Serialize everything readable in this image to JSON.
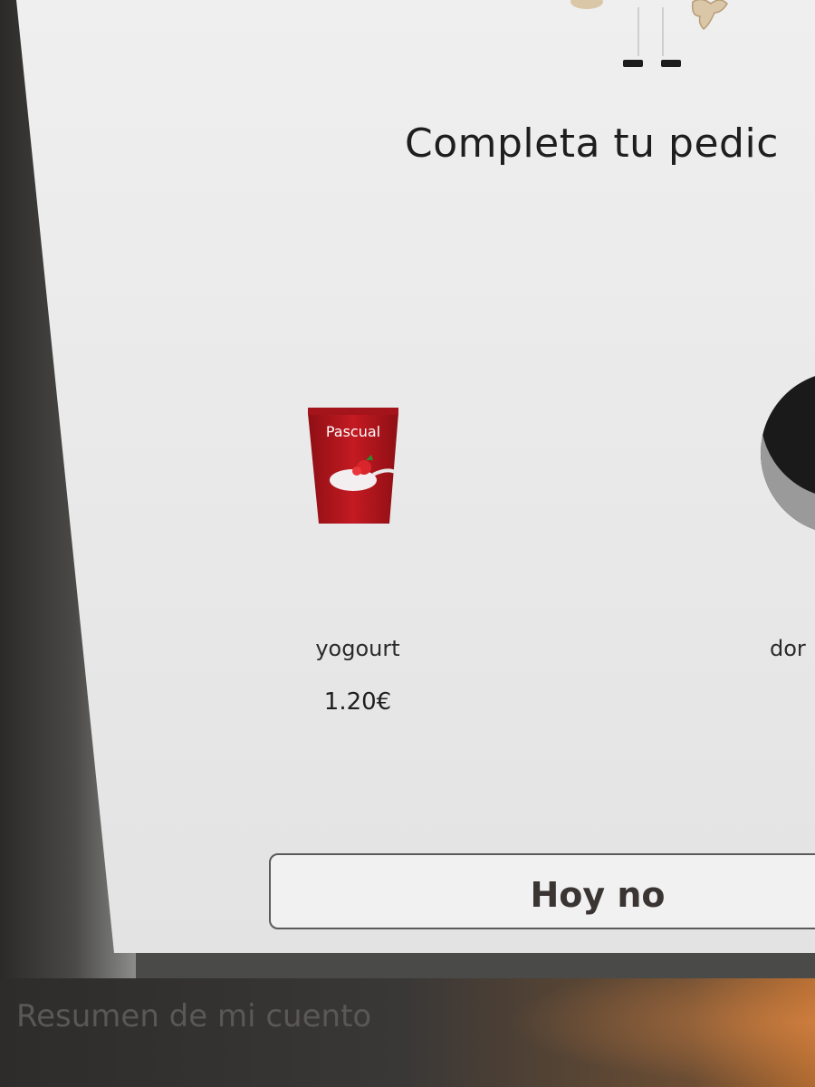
{
  "dialog": {
    "title": "Completa tu pedic"
  },
  "products": [
    {
      "name": "yogourt",
      "price": "1.20€",
      "brand": "Pascual"
    },
    {
      "name": "dor"
    }
  ],
  "actions": {
    "decline_label": "Hoy no"
  },
  "footer": {
    "label": "Resumen de mi cuento"
  },
  "colors": {
    "modal_bg": "#ececec",
    "button_border": "#5a5a5a",
    "button_text": "#3a3433",
    "yogurt_red": "#b8141c"
  }
}
